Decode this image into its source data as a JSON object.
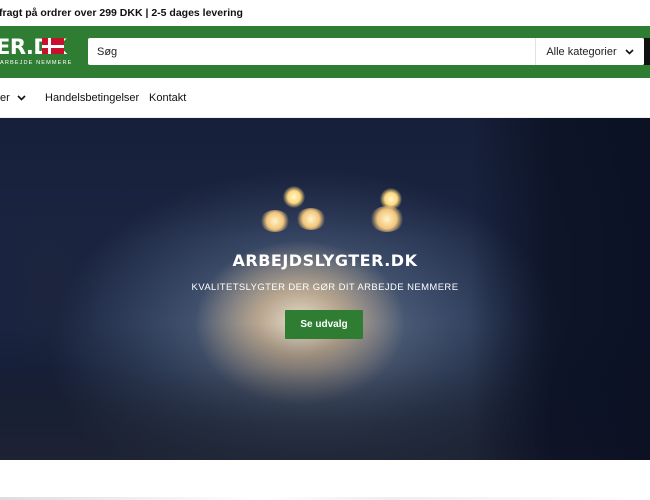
{
  "announcement": {
    "text": "fragt på ordrer over 299 DKK | 2-5 dages levering"
  },
  "header": {
    "logo_text": "ER.DK",
    "logo_subtitle": "ARBEJDE NEMMERE",
    "search_placeholder": "Søg",
    "category_label": "Alle kategorier",
    "brand_color": "#2e7d32"
  },
  "nav": {
    "items": [
      {
        "label": "er",
        "has_dropdown": true
      },
      {
        "label": "Handelsbetingelser",
        "has_dropdown": false
      },
      {
        "label": "Kontakt",
        "has_dropdown": false
      }
    ]
  },
  "hero": {
    "title": "ARBEJDSLYGTER.DK",
    "subtitle": "KVALITETSLYGTER DER GØR DIT ARBEJDE NEMMERE",
    "button_label": "Se udvalg"
  }
}
